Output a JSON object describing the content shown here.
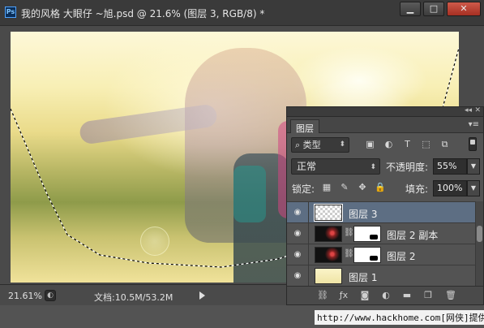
{
  "titlebar": {
    "app_icon": "ps-logo",
    "app_icon_text": "Ps",
    "title": "我的风格 大眼仔 ~旭.psd @ 21.6% (图层 3, RGB/8) *",
    "buttons": [
      {
        "name": "minimize",
        "glyph": "▁"
      },
      {
        "name": "maximize",
        "glyph": "□"
      },
      {
        "name": "close",
        "glyph": "✕"
      }
    ]
  },
  "statusbar": {
    "zoom": "21.61%",
    "doc_info": "文档:10.5M/53.2M"
  },
  "layers_panel": {
    "tab": "图层",
    "filter_label": "类型",
    "blend_mode": "正常",
    "opacity_label": "不透明度:",
    "opacity_value": "55%",
    "lock_label": "锁定:",
    "fill_label": "填充:",
    "fill_value": "100%",
    "layers": [
      {
        "name": "图层 3",
        "selected": true
      },
      {
        "name": "图层 2 副本",
        "selected": false
      },
      {
        "name": "图层 2",
        "selected": false
      },
      {
        "name": "图层 1",
        "selected": false
      }
    ],
    "bottom_icons": [
      "link-icon",
      "fx-icon",
      "mask-icon",
      "adjustment-icon",
      "folder-icon",
      "new-layer-icon",
      "trash-icon"
    ]
  },
  "watermark": "http://www.hackhome.com[网侠]提供"
}
